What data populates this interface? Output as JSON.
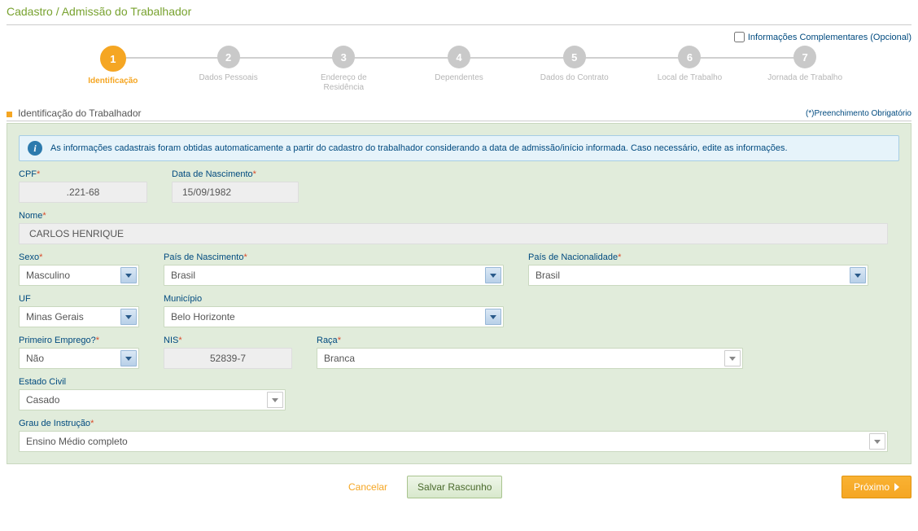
{
  "page": {
    "title": "Cadastro / Admissão do Trabalhador",
    "optionalInfoLabel": "Informações Complementares (Opcional)"
  },
  "stepper": [
    {
      "num": "1",
      "label": "Identificação",
      "active": true
    },
    {
      "num": "2",
      "label": "Dados Pessoais",
      "active": false
    },
    {
      "num": "3",
      "label": "Endereço de Residência",
      "active": false
    },
    {
      "num": "4",
      "label": "Dependentes",
      "active": false
    },
    {
      "num": "5",
      "label": "Dados do Contrato",
      "active": false
    },
    {
      "num": "6",
      "label": "Local de Trabalho",
      "active": false
    },
    {
      "num": "7",
      "label": "Jornada de Trabalho",
      "active": false
    }
  ],
  "section": {
    "title": "Identificação do Trabalhador",
    "requiredNote": "(*)Preenchimento Obrigatório"
  },
  "info": {
    "message": "As informações cadastrais foram obtidas automaticamente a partir do cadastro do trabalhador considerando a data de admissão/início informada. Caso necessário, edite as informações."
  },
  "fields": {
    "cpf": {
      "label": "CPF",
      "value": ".221-68"
    },
    "dataNasc": {
      "label": "Data de Nascimento",
      "value": "15/09/1982"
    },
    "nome": {
      "label": "Nome",
      "value": "CARLOS HENRIQUE"
    },
    "sexo": {
      "label": "Sexo",
      "value": "Masculino"
    },
    "paisNasc": {
      "label": "País de Nascimento",
      "value": "Brasil"
    },
    "paisNac": {
      "label": "País de Nacionalidade",
      "value": "Brasil"
    },
    "uf": {
      "label": "UF",
      "value": "Minas Gerais"
    },
    "municipio": {
      "label": "Município",
      "value": "Belo Horizonte"
    },
    "primeiroEmprego": {
      "label": "Primeiro Emprego?",
      "value": "Não"
    },
    "nis": {
      "label": "NIS",
      "value": "52839-7"
    },
    "raca": {
      "label": "Raça",
      "value": "Branca"
    },
    "estadoCivil": {
      "label": "Estado Civil",
      "value": "Casado"
    },
    "grauInstrucao": {
      "label": "Grau de Instrução",
      "value": "Ensino Médio completo"
    }
  },
  "footer": {
    "cancel": "Cancelar",
    "saveDraft": "Salvar Rascunho",
    "next": "Próximo"
  }
}
